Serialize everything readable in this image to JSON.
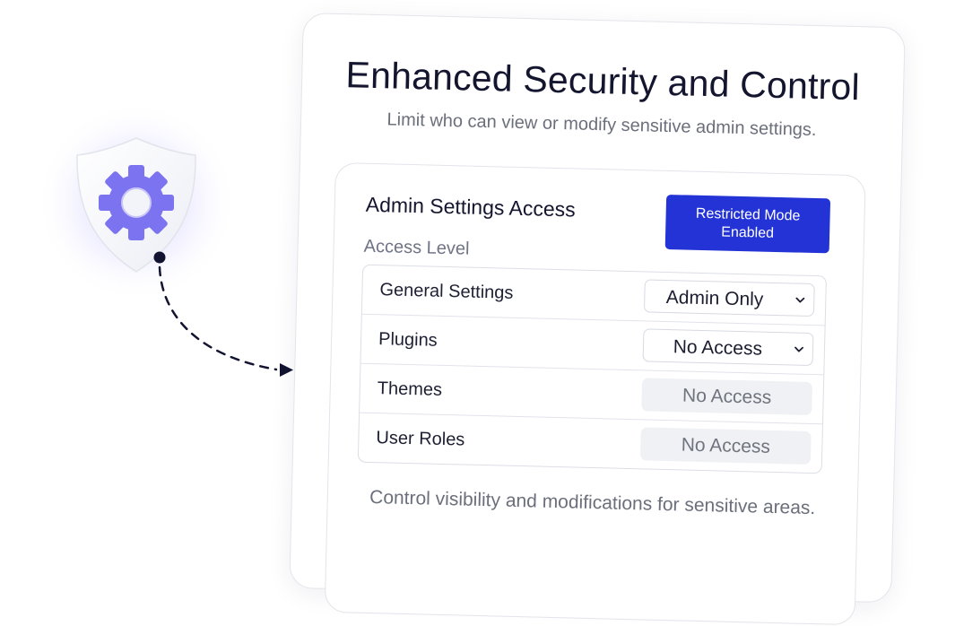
{
  "card": {
    "title": "Enhanced Security and Control",
    "subtitle": "Limit who can view or modify sensitive admin settings.",
    "footer": "Control visibility and modifications for sensitive areas."
  },
  "panel": {
    "title": "Admin Settings Access",
    "badge": "Restricted Mode Enabled",
    "access_label": "Access Level",
    "rows": [
      {
        "label": "General Settings",
        "value": "Admin Only",
        "editable": true
      },
      {
        "label": "Plugins",
        "value": "No Access",
        "editable": true
      },
      {
        "label": "Themes",
        "value": "No Access",
        "editable": false
      },
      {
        "label": "User Roles",
        "value": "No Access",
        "editable": false
      }
    ]
  },
  "icons": {
    "shield": "shield-icon",
    "gear": "gear-icon",
    "arrow": "dashed-arrow-icon",
    "chevron": "chevron-down-icon"
  },
  "colors": {
    "accent": "#2333d6",
    "gear": "#7b73f0",
    "title": "#14152e",
    "muted": "#6b6f7b"
  }
}
